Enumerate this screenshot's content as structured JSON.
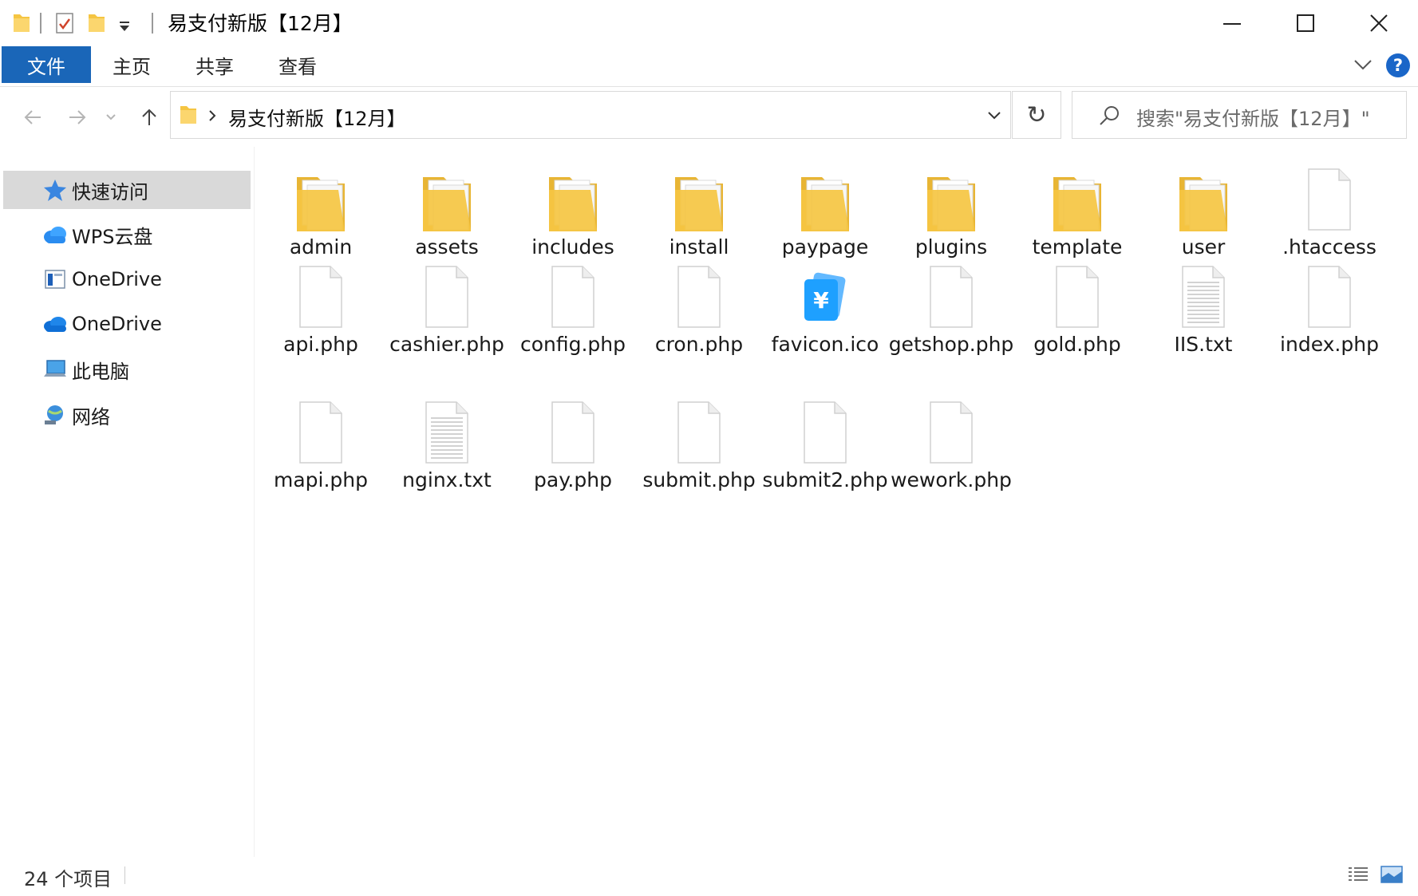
{
  "window": {
    "title": "易支付新版【12月】",
    "minimize_glyph": "—",
    "maximize_glyph": "☐",
    "close_glyph": "✕"
  },
  "ribbon": {
    "tabs": [
      "文件",
      "主页",
      "共享",
      "查看"
    ],
    "help_glyph": "?"
  },
  "address_bar": {
    "path": "易支付新版【12月】",
    "refresh_glyph": "↻"
  },
  "search": {
    "placeholder": "搜索\"易支付新版【12月】\""
  },
  "sidebar": {
    "items": [
      {
        "label": "快速访问",
        "icon": "quick-access-star-icon",
        "selected": true
      },
      {
        "label": "WPS云盘",
        "icon": "wps-cloud-icon",
        "selected": false
      },
      {
        "label": "OneDrive",
        "icon": "onedrive-window-icon",
        "selected": false
      },
      {
        "label": "OneDrive",
        "icon": "onedrive-cloud-icon",
        "selected": false
      },
      {
        "label": "此电脑",
        "icon": "this-pc-icon",
        "selected": false
      },
      {
        "label": "网络",
        "icon": "network-icon",
        "selected": false
      }
    ]
  },
  "files": [
    {
      "name": "admin",
      "type": "folder"
    },
    {
      "name": "assets",
      "type": "folder"
    },
    {
      "name": "includes",
      "type": "folder"
    },
    {
      "name": "install",
      "type": "folder"
    },
    {
      "name": "paypage",
      "type": "folder"
    },
    {
      "name": "plugins",
      "type": "folder"
    },
    {
      "name": "template",
      "type": "folder"
    },
    {
      "name": "user",
      "type": "folder"
    },
    {
      "name": ".htaccess",
      "type": "file"
    },
    {
      "name": "api.php",
      "type": "file"
    },
    {
      "name": "cashier.php",
      "type": "file"
    },
    {
      "name": "config.php",
      "type": "file"
    },
    {
      "name": "cron.php",
      "type": "file"
    },
    {
      "name": "favicon.ico",
      "type": "ico"
    },
    {
      "name": "getshop.php",
      "type": "file"
    },
    {
      "name": "gold.php",
      "type": "file"
    },
    {
      "name": "IIS.txt",
      "type": "txt"
    },
    {
      "name": "index.php",
      "type": "file"
    },
    {
      "name": "mapi.php",
      "type": "file"
    },
    {
      "name": "nginx.txt",
      "type": "txt"
    },
    {
      "name": "pay.php",
      "type": "file"
    },
    {
      "name": "submit.php",
      "type": "file"
    },
    {
      "name": "submit2.php",
      "type": "file"
    },
    {
      "name": "wework.php",
      "type": "file"
    }
  ],
  "status_bar": {
    "item_count": "24 个项目"
  },
  "colors": {
    "accent": "#1a66b8",
    "folder": "#f5c542",
    "selection": "#d9d9d9"
  }
}
